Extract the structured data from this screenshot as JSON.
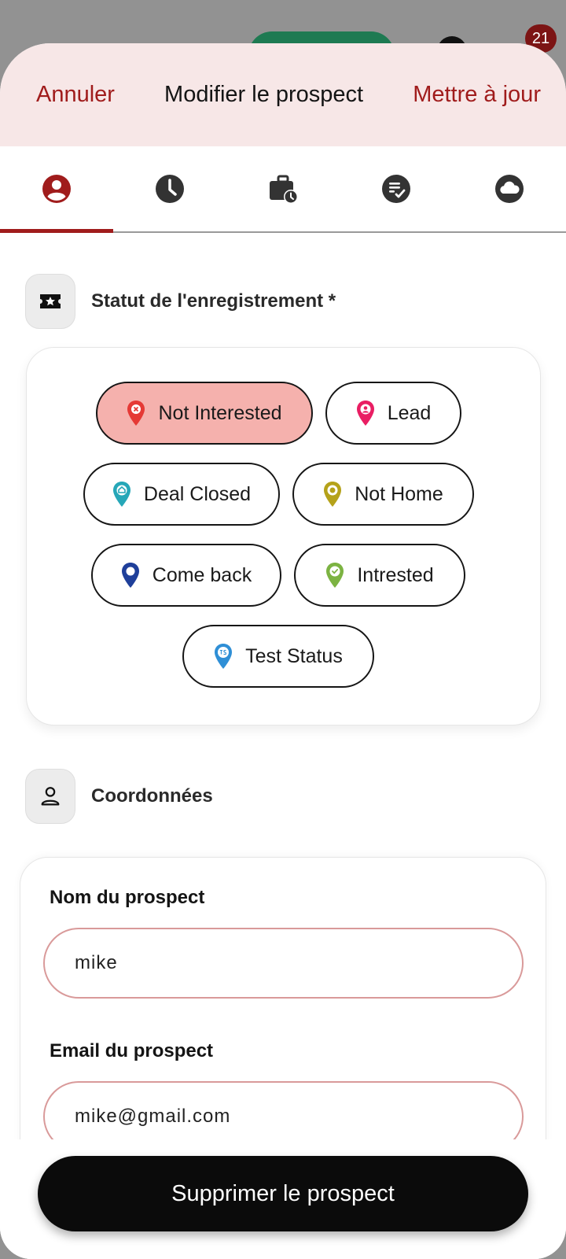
{
  "background": {
    "badge_count": "21"
  },
  "header": {
    "cancel_label": "Annuler",
    "title": "Modifier le prospect",
    "update_label": "Mettre à jour"
  },
  "tabs": [
    {
      "icon": "person-circle-icon",
      "active": true
    },
    {
      "icon": "clock-icon",
      "active": false
    },
    {
      "icon": "briefcase-clock-icon",
      "active": false
    },
    {
      "icon": "checklist-icon",
      "active": false
    },
    {
      "icon": "cloud-icon",
      "active": false
    }
  ],
  "status_section": {
    "title": "Statut de l'enregistrement *",
    "icon": "ticket-star-icon",
    "chips": [
      {
        "label": "Not Interested",
        "color": "#e53935",
        "selected": true
      },
      {
        "label": "Lead",
        "color": "#e91e63",
        "selected": false
      },
      {
        "label": "Deal Closed",
        "color": "#26a7b8",
        "selected": false
      },
      {
        "label": "Not Home",
        "color": "#b5a21a",
        "selected": false
      },
      {
        "label": "Come back",
        "color": "#1f3f9a",
        "selected": false
      },
      {
        "label": "Intrested",
        "color": "#7cb342",
        "selected": false
      },
      {
        "label": "Test Status",
        "color": "#2f8fd6",
        "selected": false
      }
    ]
  },
  "contact_section": {
    "title": "Coordonnées",
    "icon": "person-icon",
    "name_label": "Nom du prospect",
    "name_value": "mike",
    "email_label": "Email du prospect",
    "email_value": "mike@gmail.com"
  },
  "delete_label": "Supprimer le prospect",
  "colors": {
    "accent": "#a01c1c",
    "header_bg": "#f7e7e7",
    "selected_chip": "#f5b1ad"
  }
}
